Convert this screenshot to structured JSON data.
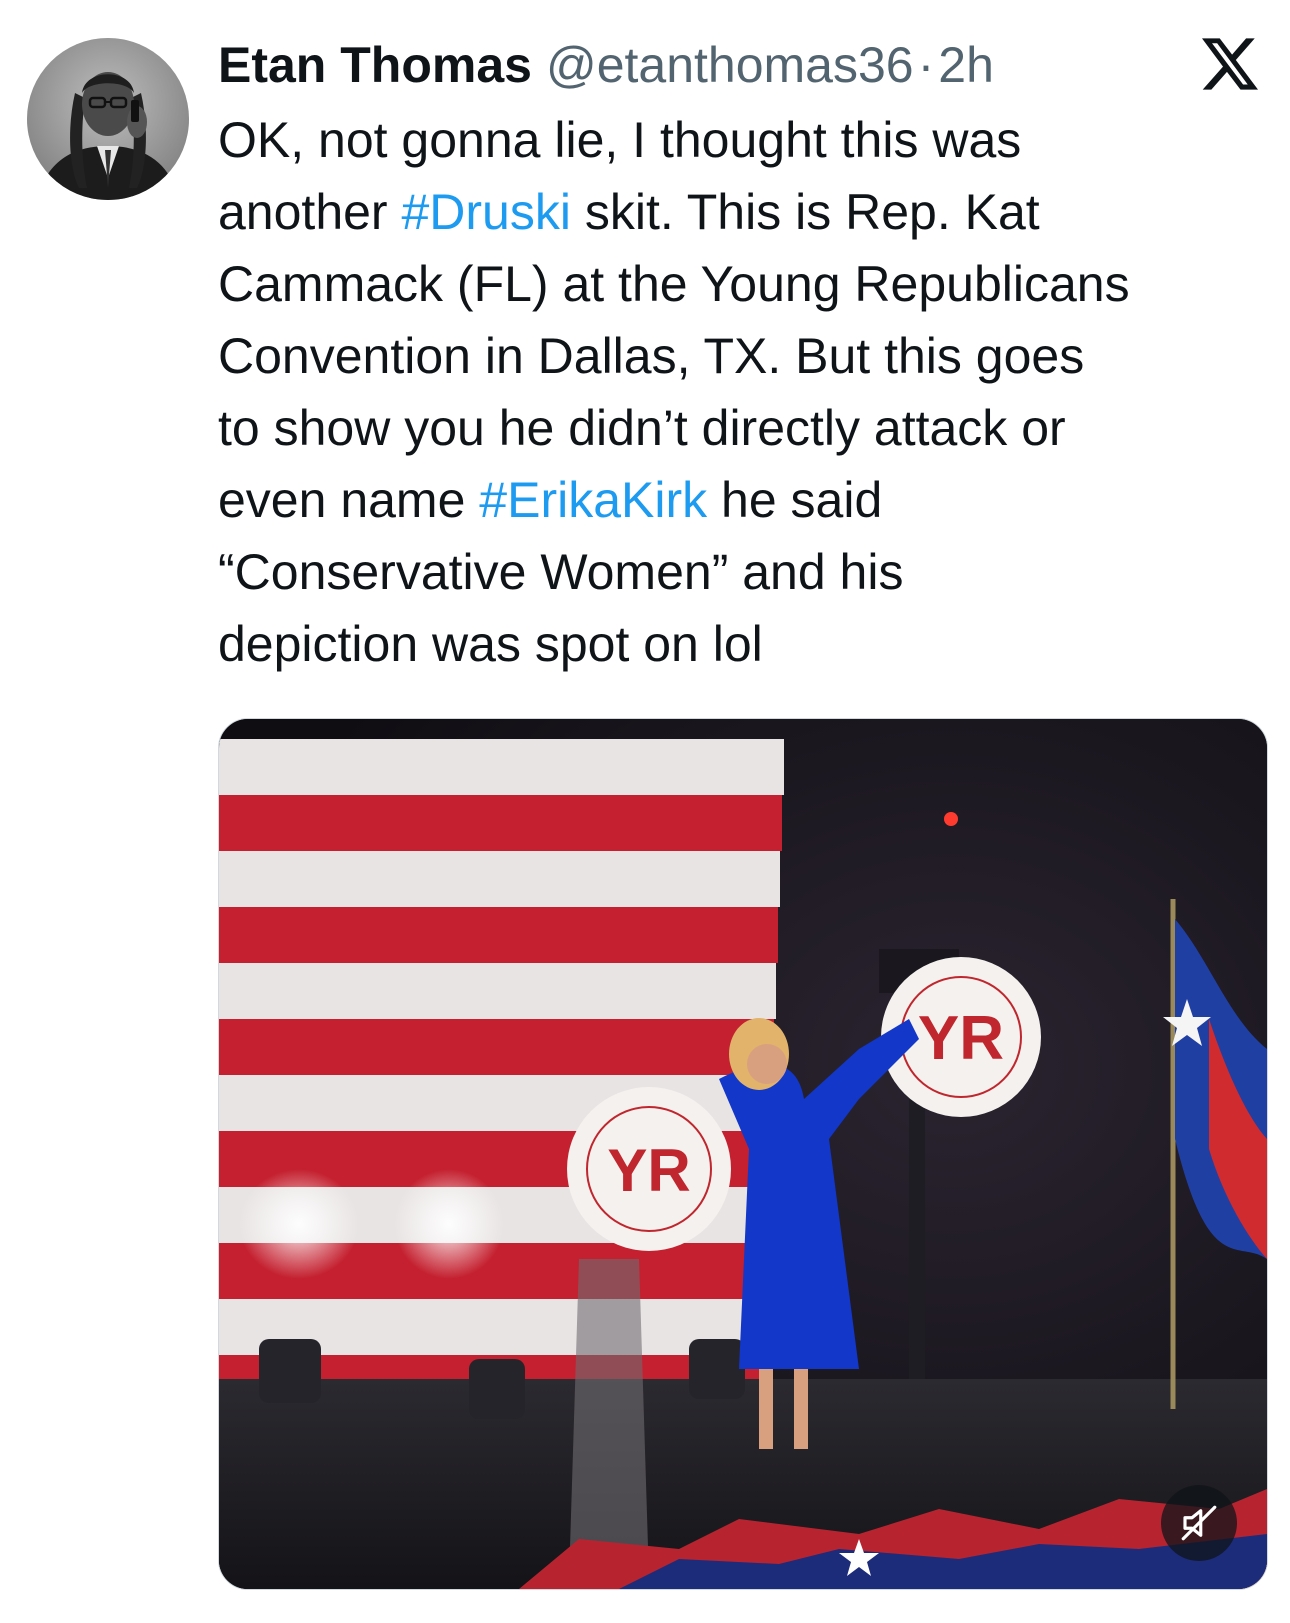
{
  "tweet": {
    "author": {
      "display_name": "Etan Thomas",
      "handle": "@etanthomas36",
      "separator": "·",
      "time": "2h"
    },
    "text_lines": [
      [
        {
          "t": "OK, not gonna lie, I thought this was"
        }
      ],
      [
        {
          "t": "another "
        },
        {
          "t": "#Druski",
          "tag": true
        },
        {
          "t": " skit. This is Rep. Kat"
        }
      ],
      [
        {
          "t": "Cammack (FL) at the Young Republicans"
        }
      ],
      [
        {
          "t": "Convention in Dallas, TX. But this goes"
        }
      ],
      [
        {
          "t": "to show you he didn’t directly attack or"
        }
      ],
      [
        {
          "t": "even name "
        },
        {
          "t": "#ErikaKirk",
          "tag": true
        },
        {
          "t": " he said"
        }
      ],
      [
        {
          "t": "“Conservative Women” and his"
        }
      ],
      [
        {
          "t": "depiction was spot on lol"
        }
      ]
    ],
    "media": {
      "kind": "video",
      "muted": true,
      "icon": "muted-speaker-icon"
    }
  },
  "icons": {
    "brand": "x-logo-icon",
    "avatar": "avatar-photo"
  },
  "colors": {
    "text": "#0f1419",
    "secondary": "#536471",
    "hashtag": "#1d9bf0"
  }
}
